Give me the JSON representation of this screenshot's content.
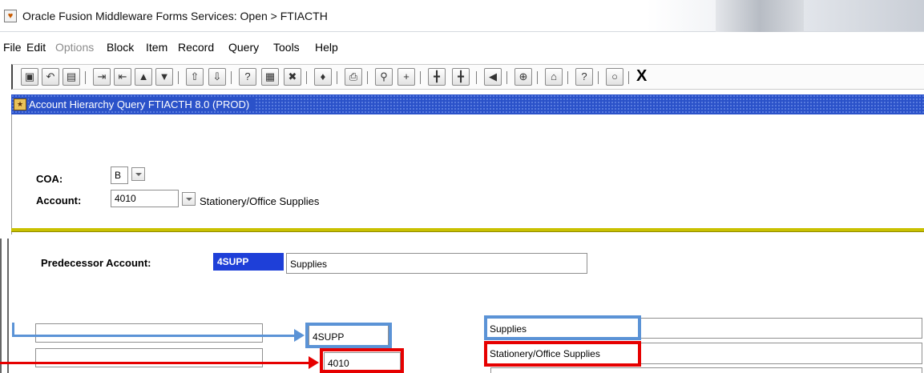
{
  "window": {
    "title": "Oracle Fusion Middleware Forms Services:  Open > FTIACTH"
  },
  "menu": {
    "items": [
      "File",
      "Edit",
      "Options",
      "Block",
      "Item",
      "Record",
      "Query",
      "Tools",
      "Help"
    ],
    "disabled": [
      "Options"
    ]
  },
  "toolbar": {
    "icons": [
      "save-icon",
      "rollback-icon",
      "print-page-icon",
      "insert-record-icon",
      "remove-record-icon",
      "previous-block-icon",
      "next-block-icon",
      "previous-record-icon",
      "next-record-icon",
      "enter-query-icon",
      "execute-query-icon",
      "cancel-query-icon",
      "attachment-icon",
      "print-icon",
      "search-icon",
      "options-icon",
      "related-icon",
      "key-icon",
      "audio-icon",
      "target-icon",
      "home-icon",
      "help-icon",
      "light-bulb-icon"
    ],
    "exit_label": "X"
  },
  "form": {
    "title": "Account Hierarchy Query  FTIACTH 8.0  (PROD)"
  },
  "key_block": {
    "coa_label": "COA:",
    "coa_value": "B",
    "account_label": "Account:",
    "account_value": "4010",
    "account_desc": "Stationery/Office Supplies"
  },
  "predecessor": {
    "label": "Predecessor Account:",
    "value": "4SUPP",
    "desc": "Supplies"
  },
  "hierarchy_rows": [
    {
      "code": "4SUPP",
      "desc": "Supplies"
    },
    {
      "code": "4010",
      "desc": "Stationery/Office Supplies"
    }
  ],
  "colors": {
    "header_blue": "#2b52c9",
    "selection_blue": "#1e3fd8",
    "annotation_blue": "#5b93d6",
    "annotation_red": "#e60000",
    "olive_bar": "#c9c100"
  }
}
